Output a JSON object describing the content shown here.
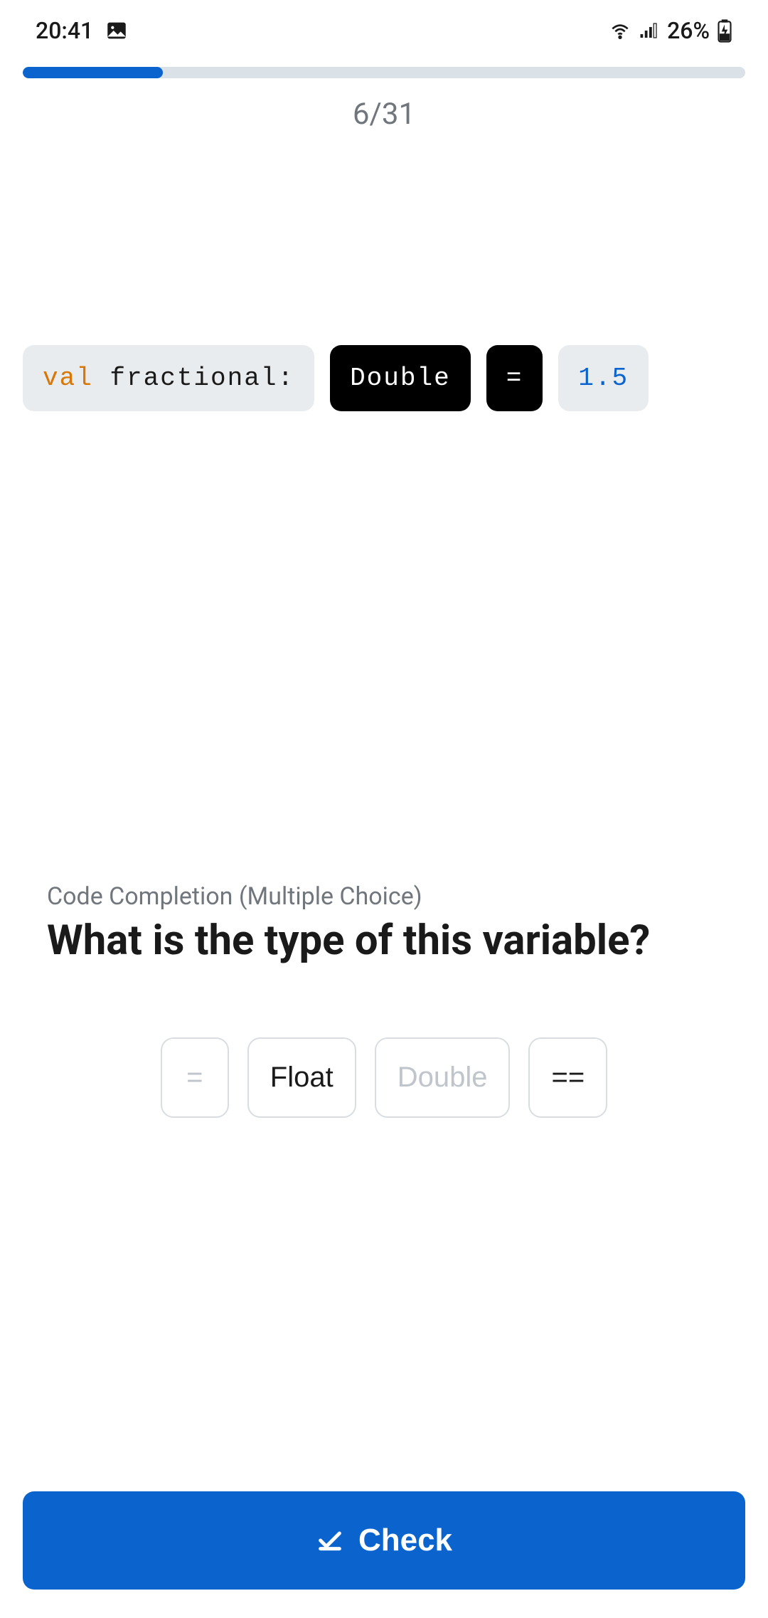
{
  "statusBar": {
    "time": "20:41",
    "battery": "26%"
  },
  "progress": {
    "current": 6,
    "total": 31,
    "text": "6/31",
    "percent": 19.4
  },
  "code": {
    "declaration_keyword": "val",
    "declaration_name": " fractional:",
    "selected_type": "Double",
    "equals": "=",
    "value": "1.5"
  },
  "question": {
    "category": "Code Completion (Multiple Choice)",
    "title": "What is the type of this variable?"
  },
  "choices": [
    {
      "label": "=",
      "disabled": true
    },
    {
      "label": "Float",
      "disabled": false
    },
    {
      "label": "Double",
      "disabled": true
    },
    {
      "label": "==",
      "disabled": false
    }
  ],
  "checkButton": {
    "label": "Check"
  }
}
